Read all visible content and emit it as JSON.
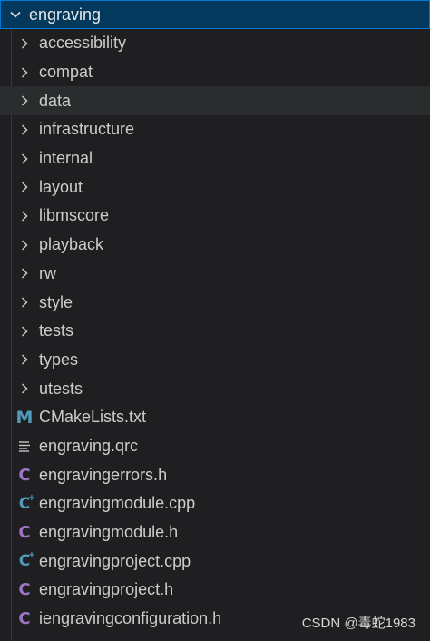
{
  "root": {
    "label": "engraving",
    "expanded_icon": "chevron-down-icon"
  },
  "items": [
    {
      "label": "accessibility",
      "kind": "folder",
      "icon": "chevron-right-icon"
    },
    {
      "label": "compat",
      "kind": "folder",
      "icon": "chevron-right-icon"
    },
    {
      "label": "data",
      "kind": "folder",
      "icon": "chevron-right-icon",
      "hover": true
    },
    {
      "label": "infrastructure",
      "kind": "folder",
      "icon": "chevron-right-icon"
    },
    {
      "label": "internal",
      "kind": "folder",
      "icon": "chevron-right-icon"
    },
    {
      "label": "layout",
      "kind": "folder",
      "icon": "chevron-right-icon"
    },
    {
      "label": "libmscore",
      "kind": "folder",
      "icon": "chevron-right-icon"
    },
    {
      "label": "playback",
      "kind": "folder",
      "icon": "chevron-right-icon"
    },
    {
      "label": "rw",
      "kind": "folder",
      "icon": "chevron-right-icon"
    },
    {
      "label": "style",
      "kind": "folder",
      "icon": "chevron-right-icon"
    },
    {
      "label": "tests",
      "kind": "folder",
      "icon": "chevron-right-icon"
    },
    {
      "label": "types",
      "kind": "folder",
      "icon": "chevron-right-icon"
    },
    {
      "label": "utests",
      "kind": "folder",
      "icon": "chevron-right-icon"
    },
    {
      "label": "CMakeLists.txt",
      "kind": "cmake",
      "icon": "cmake-file-icon"
    },
    {
      "label": "engraving.qrc",
      "kind": "text",
      "icon": "text-lines-icon"
    },
    {
      "label": "engravingerrors.h",
      "kind": "c",
      "icon": "c-header-icon"
    },
    {
      "label": "engravingmodule.cpp",
      "kind": "cpp",
      "icon": "cpp-file-icon"
    },
    {
      "label": "engravingmodule.h",
      "kind": "c",
      "icon": "c-header-icon"
    },
    {
      "label": "engravingproject.cpp",
      "kind": "cpp",
      "icon": "cpp-file-icon"
    },
    {
      "label": "engravingproject.h",
      "kind": "c",
      "icon": "c-header-icon"
    },
    {
      "label": "iengravingconfiguration.h",
      "kind": "c",
      "icon": "c-header-icon"
    }
  ],
  "watermark": "CSDN @毒蛇1983",
  "colors": {
    "background": "#1f1f22",
    "selection": "#04395e",
    "selection_border": "#0078d4",
    "hover": "#2a2d2e",
    "text": "#cccccc",
    "cmake_icon": "#519aba",
    "c_icon": "#a074c4",
    "cpp_icon": "#519aba"
  }
}
